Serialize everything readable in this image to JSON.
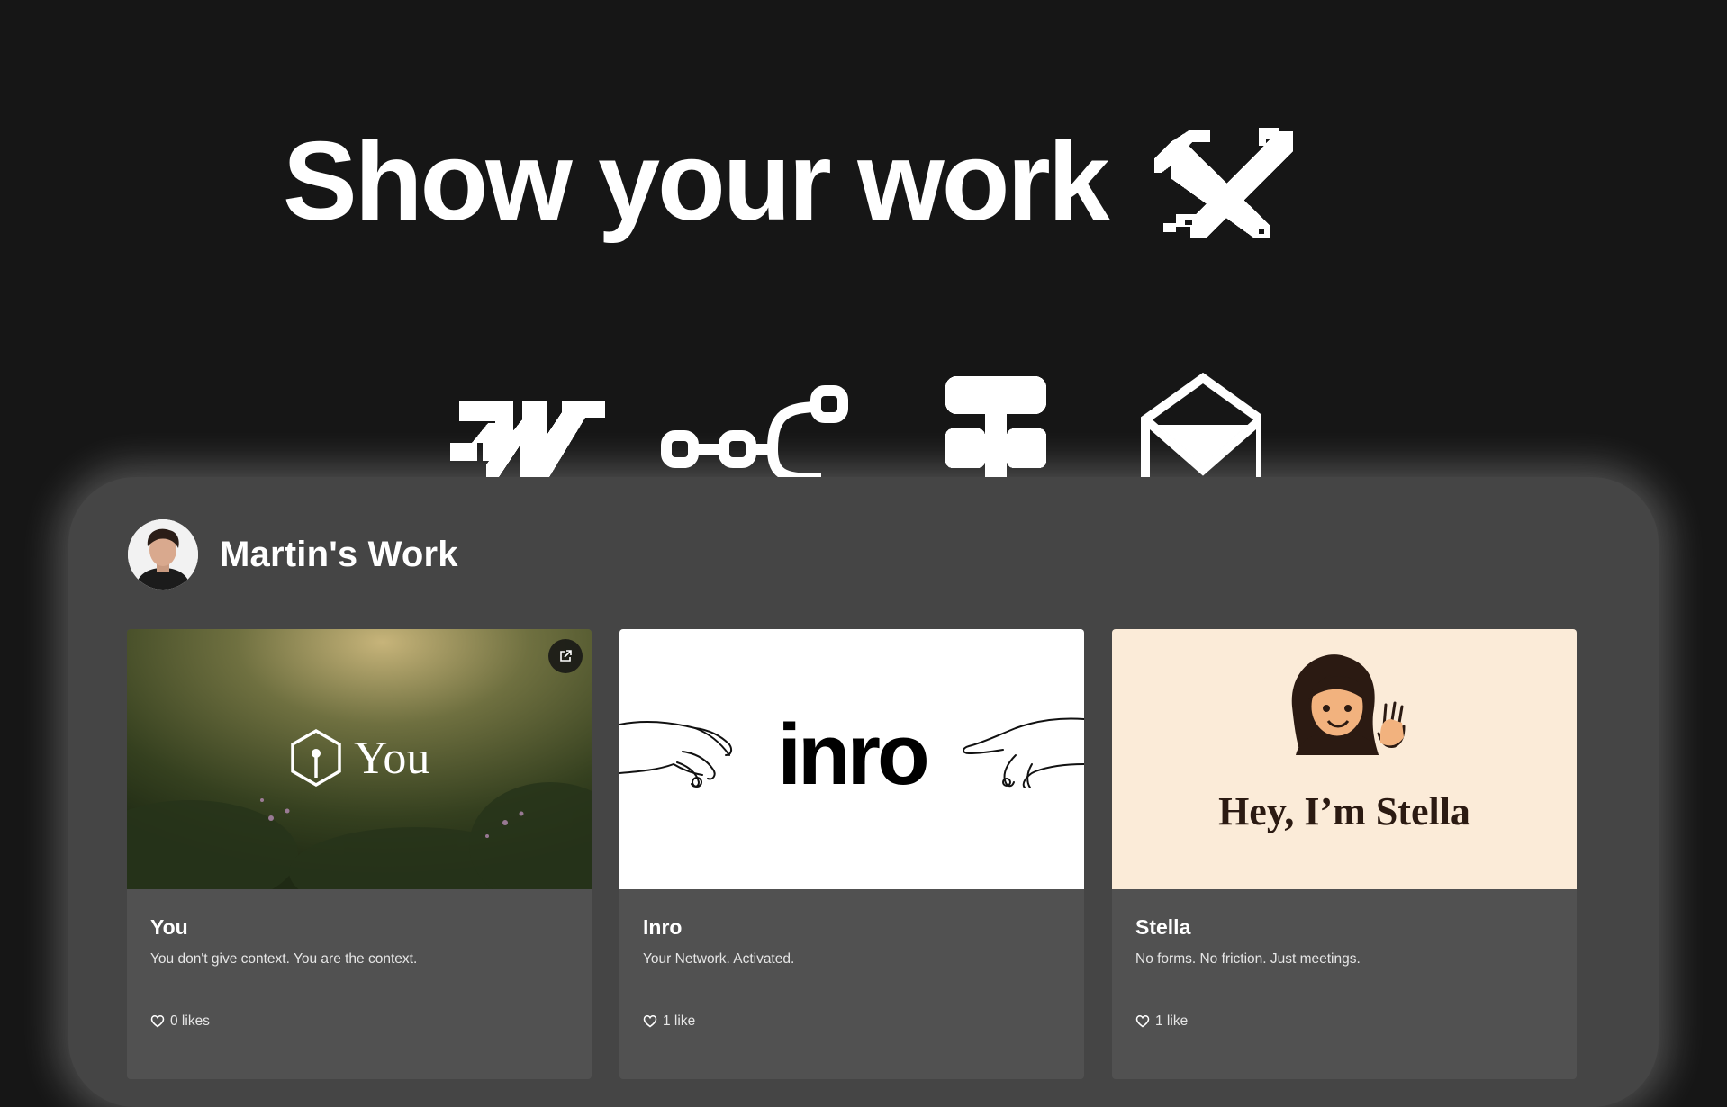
{
  "hero": {
    "title": "Show your work",
    "icon": "tools-icon"
  },
  "integrations": [
    "webflow-icon",
    "flow-icon",
    "tree-icon",
    "mail-icon"
  ],
  "profile": {
    "name": "Martin's Work",
    "avatar": "avatar-image"
  },
  "cards": [
    {
      "title": "You",
      "description": "You don't give context. You are the context.",
      "likes": "0 likes",
      "image_logo": "You"
    },
    {
      "title": "Inro",
      "description": "Your Network. Activated.",
      "likes": "1 like",
      "image_logo": "inro"
    },
    {
      "title": "Stella",
      "description": "No forms. No friction. Just meetings.",
      "likes": "1 like",
      "image_logo": "Hey, I’m Stella"
    }
  ],
  "colors": {
    "background": "#161616",
    "panel": "#454545",
    "card": "#515151",
    "stella_bg": "#fbebd8"
  }
}
